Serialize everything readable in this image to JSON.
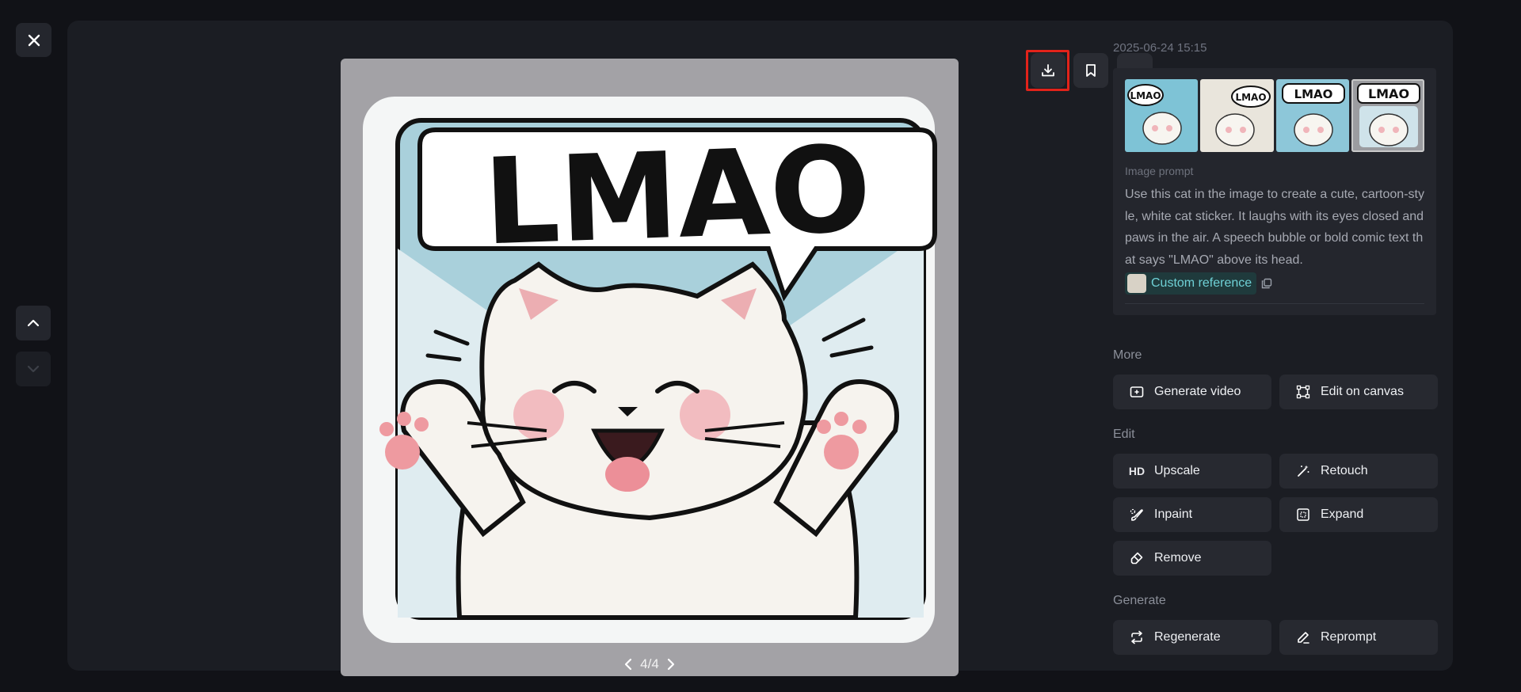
{
  "viewer": {
    "page_indicator": "4/4"
  },
  "sticker": {
    "caption": "LMAO"
  },
  "sidebar": {
    "timestamp": "2025-06-24 15:15",
    "prompt_label": "Image prompt",
    "prompt_text": "Use this cat in the image to create a cute, cartoon-style, white cat sticker. It laughs with its eyes closed and paws in the air. A speech bubble or bold comic text that says \"LMAO\" above its head.",
    "custom_reference": "Custom reference",
    "thumbnails": [
      {
        "caption": "LMAO",
        "bg": "#7ec3d6"
      },
      {
        "caption": "LMAO",
        "bg": "#e9e5dc"
      },
      {
        "caption": "LMAO",
        "bg": "#8dc7d9"
      },
      {
        "caption": "LMAO",
        "bg": "#9b9ca0"
      }
    ],
    "sections": {
      "more": "More",
      "edit": "Edit",
      "generate": "Generate"
    },
    "actions": {
      "generate_video": "Generate video",
      "edit_on_canvas": "Edit on canvas",
      "upscale": "Upscale",
      "upscale_badge": "HD",
      "retouch": "Retouch",
      "inpaint": "Inpaint",
      "expand": "Expand",
      "remove": "Remove",
      "regenerate": "Regenerate",
      "reprompt": "Reprompt"
    }
  },
  "icons": {
    "close": "close-icon",
    "up": "chevron-up-icon",
    "down": "chevron-down-icon",
    "download": "download-icon",
    "bookmark": "bookmark-icon",
    "more": "more-horizontal-icon"
  },
  "colors": {
    "background": "#111217",
    "panel": "#1b1d23",
    "highlight": "#e2231a",
    "reference_text": "#6fd1d6"
  }
}
